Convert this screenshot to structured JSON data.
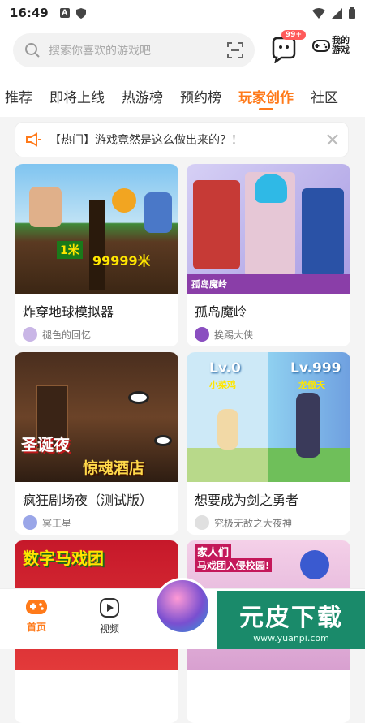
{
  "status": {
    "time": "16:49",
    "icon_a": "A"
  },
  "search": {
    "placeholder": "搜索你喜欢的游戏吧"
  },
  "header": {
    "badge": "99+",
    "my_games_line1": "我的",
    "my_games_line2": "游戏"
  },
  "tabs": [
    {
      "label": "推荐",
      "active": false
    },
    {
      "label": "即将上线",
      "active": false
    },
    {
      "label": "热游榜",
      "active": false
    },
    {
      "label": "预约榜",
      "active": false
    },
    {
      "label": "玩家创作",
      "active": true
    },
    {
      "label": "社区",
      "active": false
    }
  ],
  "notice": {
    "text": "【热门】游戏竟然是这么做出来的？！"
  },
  "cards": [
    {
      "title": "炸穿地球模拟器",
      "author": "褪色的回忆",
      "thumb_text_1": "1米",
      "thumb_text_2": "99999米"
    },
    {
      "title": "孤岛魔岭",
      "author": "挨踢大侠",
      "thumb_text_1": "孤岛魔岭"
    },
    {
      "title": "疯狂剧场夜（测试版）",
      "author": "冥王星",
      "thumb_text_1": "圣诞夜",
      "thumb_text_2": "惊魂酒店"
    },
    {
      "title": "想要成为剑之勇者",
      "author": "究极无敌之大夜神",
      "thumb_text_1": "Lv.0",
      "thumb_text_2": "小菜鸡",
      "thumb_text_3": "Lv.999",
      "thumb_text_4": "龙傲天"
    },
    {
      "title": "",
      "author": "",
      "thumb_text_1": "数字马戏团"
    },
    {
      "title": "",
      "author": "",
      "thumb_text_1": "家人们",
      "thumb_text_2": "马戏团入侵校园!"
    }
  ],
  "bottom_nav": {
    "home": "首页",
    "video": "视频"
  },
  "watermark": {
    "main": "元皮下载",
    "url": "www.yuanpi.com"
  },
  "colors": {
    "accent": "#ff7a1a",
    "badge": "#ff5a5a"
  }
}
